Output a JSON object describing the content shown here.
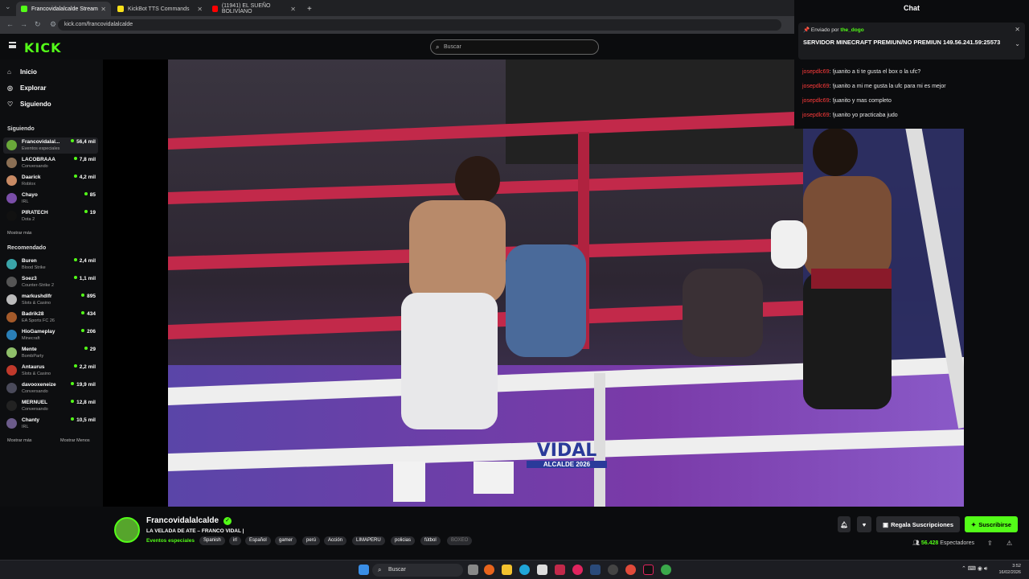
{
  "browser": {
    "tabs": [
      {
        "label": "Francovidalalcalde Stream"
      },
      {
        "label": "KickBot TTS Commands"
      },
      {
        "label": "(11941) EL SUEÑO BOLIVIANO"
      }
    ],
    "url": "kick.com/francovidalalcalde"
  },
  "header": {
    "logo": "KICK",
    "search_placeholder": "Buscar"
  },
  "sidebar": {
    "nav": [
      {
        "label": "Inicio",
        "icon": "home-icon"
      },
      {
        "label": "Explorar",
        "icon": "compass-icon"
      },
      {
        "label": "Siguiendo",
        "icon": "heart-icon"
      }
    ],
    "following_title": "Siguiendo",
    "following": [
      {
        "name": "Francovidalal...",
        "category": "Eventos especiales",
        "viewers": "56,4 mil"
      },
      {
        "name": "LACOBRAAA",
        "category": "Conversando",
        "viewers": "7,8 mil"
      },
      {
        "name": "Daarick",
        "category": "Roblox",
        "viewers": "4,2 mil"
      },
      {
        "name": "Chayo",
        "category": "IRL",
        "viewers": "85"
      },
      {
        "name": "PIRATECH",
        "category": "Dota 2",
        "viewers": "19"
      }
    ],
    "show_more": "Mostrar más",
    "recommended_title": "Recomendado",
    "recommended": [
      {
        "name": "Buren",
        "category": "Blood Strike",
        "viewers": "2,4 mil"
      },
      {
        "name": "Soez3",
        "category": "Counter-Strike 2",
        "viewers": "1,1 mil"
      },
      {
        "name": "markushdlfr",
        "category": "Slots & Casino",
        "viewers": "895"
      },
      {
        "name": "Badrik28",
        "category": "EA Sports FC 26",
        "viewers": "434"
      },
      {
        "name": "HioGameplay",
        "category": "Minecraft",
        "viewers": "206"
      },
      {
        "name": "Mente",
        "category": "BombParty",
        "viewers": "29"
      },
      {
        "name": "Antaurus",
        "category": "Slots & Casino",
        "viewers": "2,2 mil"
      },
      {
        "name": "davooxeneize",
        "category": "Conversando",
        "viewers": "19,9 mil"
      },
      {
        "name": "MERNUEL",
        "category": "Conversando",
        "viewers": "12,8 mil"
      },
      {
        "name": "Chanty",
        "category": "IRL",
        "viewers": "10,5 mil"
      }
    ],
    "show_more_2": "Mostrar más",
    "show_less": "Mostrar Menos"
  },
  "chat": {
    "title": "Chat",
    "pinned_by_label": "Enviado por",
    "pinned_user": "the_dogo",
    "pinned_message": "SERVIDOR MINECRAFT PREMIUN/NO PREMIUN 149.56.241.59:25573",
    "messages": [
      {
        "user": "josepdlc69",
        "text": ": !juanito a ti te gusta el box o la ufc?"
      },
      {
        "user": "josepdlc69",
        "text": ": !juanito a mi me gusta la ufc para mi es mejor"
      },
      {
        "user": "josepdlc69",
        "text": ": !juanito y mas completo"
      },
      {
        "user": "josepdlc69",
        "text": ": !juanito yo practicaba judo"
      }
    ]
  },
  "video": {
    "overlay_logo": "VIDAL",
    "overlay_sub": "ALCALDE 2026"
  },
  "stream": {
    "channel": "Francovidalalcalde",
    "title": "LA VELADA DE ATE – FRANCO VIDAL |",
    "category": "Eventos especiales",
    "tags": [
      "Spanish",
      "irl",
      "Español",
      "gamer",
      "perú",
      "Acción",
      "LIMAPERU",
      "policias",
      "fútbol",
      "BOXEO"
    ],
    "gift_label": "Regala Suscripciones",
    "subscribe_label": "Suscribirse",
    "viewers_count": "56.428",
    "viewers_label": "Espectadores"
  },
  "taskbar": {
    "search": "Buscar",
    "time": "3:52",
    "date": "16/02/2026"
  },
  "colors": {
    "accent": "#53fc18",
    "chat_user": "#ff3b3b"
  }
}
